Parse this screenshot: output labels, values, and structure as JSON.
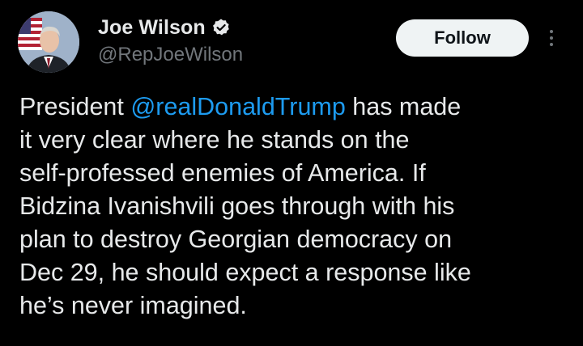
{
  "author": {
    "display_name": "Joe Wilson",
    "handle": "@RepJoeWilson",
    "verified_icon": "verified-badge-icon",
    "verified_color": "#1d9bf0"
  },
  "actions": {
    "follow_label": "Follow",
    "more_icon": "more-options-icon"
  },
  "tweet": {
    "text_lines": [
      {
        "before": "President ",
        "mention": "@realDonaldTrump",
        "after": " has made"
      },
      {
        "text": "it very clear where he stands on the"
      },
      {
        "text": "self-professed enemies of America. If"
      },
      {
        "text": "Bidzina Ivanishvili goes through with his"
      },
      {
        "text": "plan to destroy Georgian democracy on"
      },
      {
        "text": "Dec 29, he should expect a response like"
      },
      {
        "text": "he’s never imagined."
      }
    ]
  },
  "colors": {
    "background": "#000000",
    "text": "#e7e9ea",
    "secondary_text": "#71767b",
    "link": "#1d9bf0",
    "follow_button_bg": "#eff3f4"
  }
}
